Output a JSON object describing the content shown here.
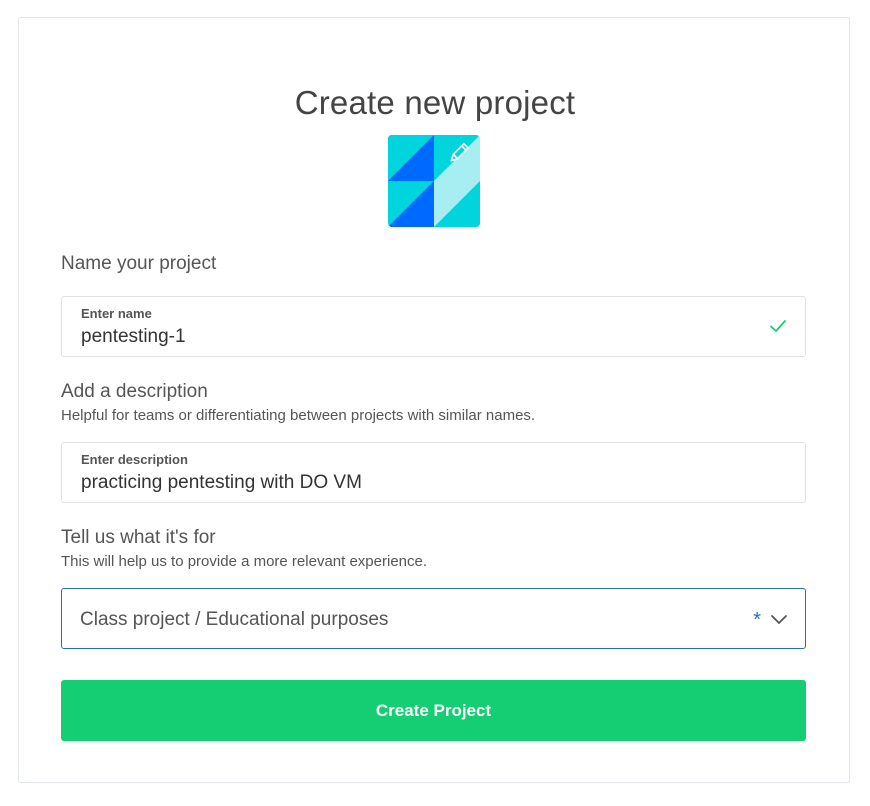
{
  "page": {
    "title": "Create new project"
  },
  "name_section": {
    "label": "Name your project",
    "field_label": "Enter name",
    "value": "pentesting-1",
    "icon": "check-icon"
  },
  "description_section": {
    "label": "Add a description",
    "help": "Helpful for teams or differentiating between projects with similar names.",
    "field_label": "Enter description",
    "value": "practicing pentesting with DO VM"
  },
  "purpose_section": {
    "label": "Tell us what it's for",
    "help": "This will help us to provide a more relevant experience.",
    "selected": "Class project / Educational purposes",
    "required_mark": "*"
  },
  "submit": {
    "label": "Create Project"
  },
  "colors": {
    "accent_green": "#15cd72",
    "select_border": "#2b6fb3",
    "avatar_blue": "#0069ff",
    "avatar_cyan": "#00d4dc",
    "avatar_light": "#a6eef2"
  },
  "icons": [
    "pencil-icon",
    "check-icon",
    "chevron-down-icon"
  ]
}
